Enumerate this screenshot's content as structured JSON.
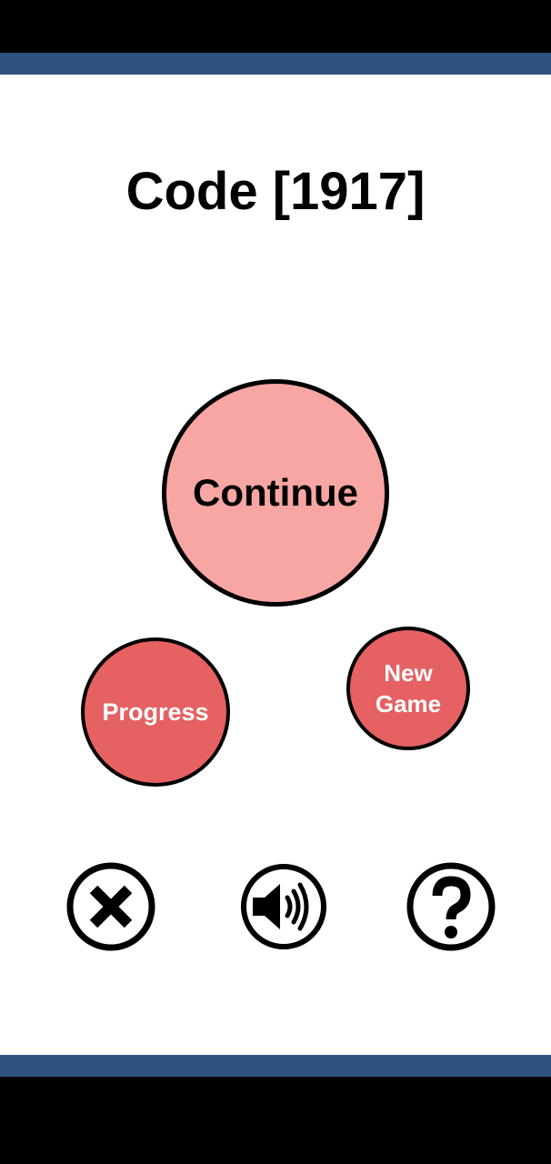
{
  "title": "Code [1917]",
  "buttons": {
    "continue": "Continue",
    "progress": "Progress",
    "new_game_line1": "New",
    "new_game_line2": "Game"
  },
  "icons": {
    "exit": "close-icon",
    "sound": "speaker-icon",
    "help": "question-mark-icon"
  },
  "colors": {
    "band": "#30527f",
    "continue_fill": "#f8a6a4",
    "secondary_fill": "#e56162"
  }
}
